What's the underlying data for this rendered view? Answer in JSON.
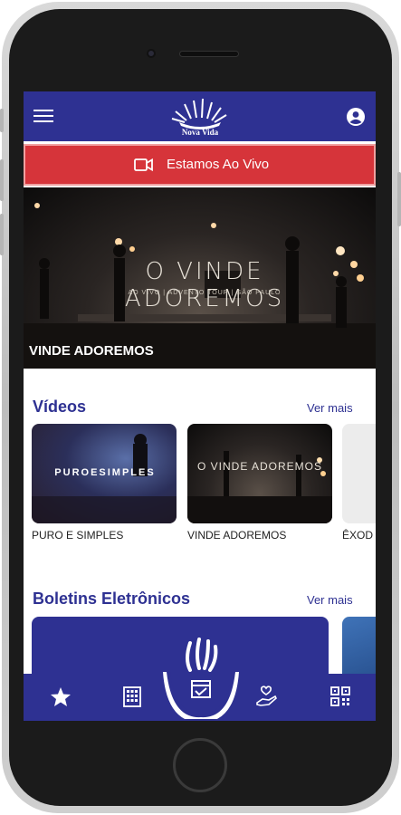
{
  "app": {
    "logo_text": "Nova Vida",
    "brand_color": "#2e3192",
    "live_color": "#d6343a"
  },
  "header": {
    "menu_icon": "hamburger-menu-icon",
    "account_icon": "account-circle-icon"
  },
  "live": {
    "label": "Estamos Ao Vivo",
    "icon": "video-camera-icon"
  },
  "hero": {
    "title": "O VINDE ADOREMOS",
    "subtitle": "AO VIVO | ADVENTO TOUR | SÃO PAULO",
    "caption": "VINDE ADOREMOS"
  },
  "videos": {
    "title": "Vídeos",
    "see_more": "Ver mais",
    "items": [
      {
        "label": "PURO E SIMPLES",
        "thumb_text": "PUROESIMPLES"
      },
      {
        "label": "VINDE ADOREMOS",
        "thumb_text": "O VINDE ADOREMOS"
      },
      {
        "label": "ÊXOD"
      }
    ]
  },
  "bulletins": {
    "title": "Boletins Eletrônicos",
    "see_more": "Ver mais"
  },
  "tabbar": {
    "items": [
      {
        "icon": "star-icon"
      },
      {
        "icon": "building-icon"
      },
      {
        "icon": "calendar-check-icon"
      },
      {
        "icon": "hand-heart-icon"
      },
      {
        "icon": "qr-code-icon"
      }
    ]
  }
}
